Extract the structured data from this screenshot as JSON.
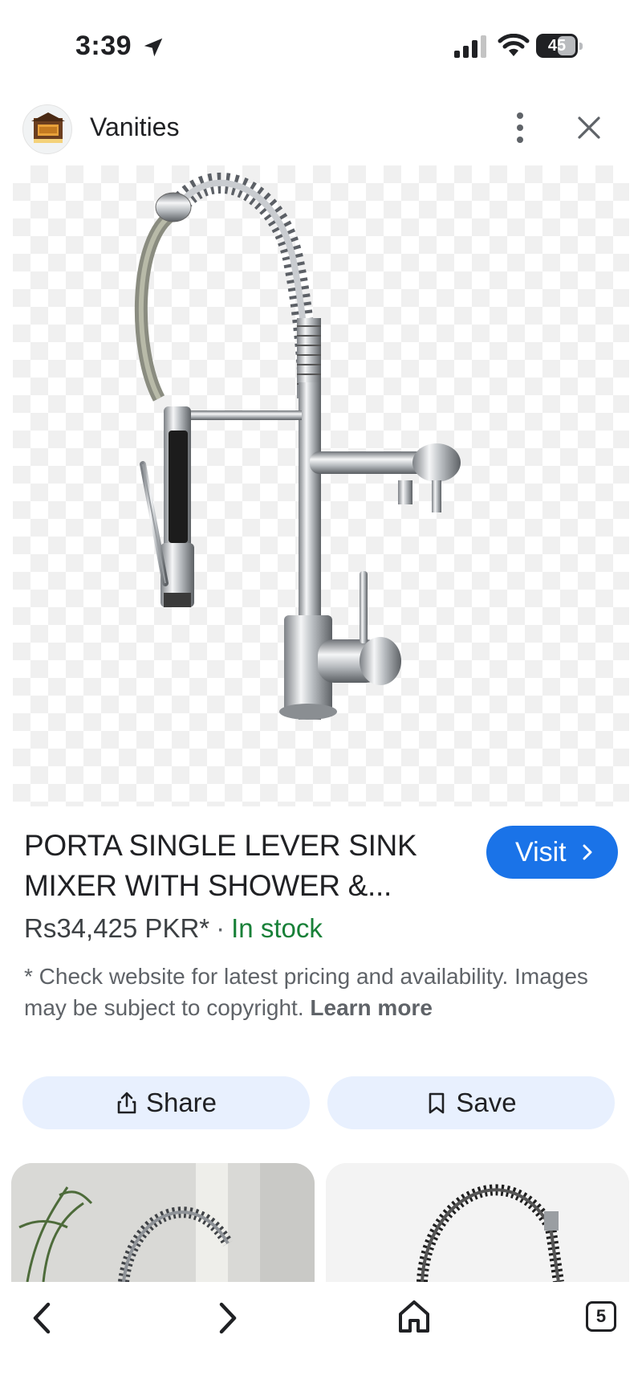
{
  "status_bar": {
    "time": "3:39",
    "battery": "45",
    "icons": [
      "location-arrow-icon",
      "cellular-signal-icon",
      "wifi-icon",
      "battery-icon"
    ]
  },
  "header": {
    "site_name": "Vanities",
    "favicon": "vanities-logo",
    "more_icon": "more-vert-icon",
    "close_icon": "close-icon"
  },
  "product": {
    "image_alt": "chrome pull-down kitchen faucet",
    "title": "PORTA SINGLE LEVER SINK MIXER WITH SHOWER &...",
    "visit_label": "Visit",
    "price": "Rs34,425 PKR*",
    "separator": "·",
    "stock": "In stock",
    "disclaimer": "* Check website for latest pricing and availability. Images may be subject to copyright.",
    "learn_more": "Learn more"
  },
  "actions": {
    "share_label": "Share",
    "save_label": "Save"
  },
  "bottom_nav": {
    "tab_count": "5"
  },
  "colors": {
    "accent": "#1a73e8",
    "stock_green": "#188038",
    "chip_bg": "#e8f0fe"
  }
}
